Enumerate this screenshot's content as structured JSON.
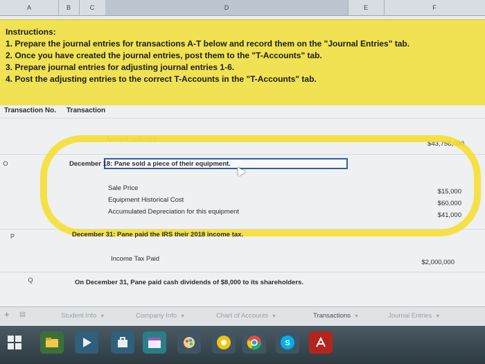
{
  "columns": [
    "A",
    "B",
    "C",
    "D",
    "E",
    "F"
  ],
  "instructions": {
    "heading": "Instructions:",
    "items": [
      "1. Prepare the journal entries for transactions A-T below and record them on the \"Journal Entries\" tab.",
      "2. Once you have created the journal entries, post them to the \"T-Accounts\" tab.",
      "3. Prepare journal entries for adjusting journal entries 1-6.",
      "4. Post the adjusting entries to the correct T-Accounts in the \"T-Accounts\" tab."
    ]
  },
  "table_header": {
    "transaction_no": "Transaction No.",
    "transaction": "Transaction"
  },
  "rows": {
    "amount_collected": {
      "label": "Amount collected",
      "value": "$43,758,000"
    },
    "O": {
      "id": "O",
      "description": "December 18: Pane sold a piece of their equipment.",
      "details": [
        {
          "label": "Sale Price",
          "value": "$15,000"
        },
        {
          "label": "Equipment Historical Cost",
          "value": "$60,000"
        },
        {
          "label": "Accumulated Depreciation for this equipment",
          "value": "$41,000"
        }
      ]
    },
    "P": {
      "id": "P",
      "description": "December 31: Pane paid the IRS their 2018 income tax.",
      "detail_label": "Income Tax Paid",
      "detail_value": "$2,000,000"
    },
    "Q": {
      "id": "Q",
      "description": "On December 31, Pane paid cash dividends of $8,000 to its shareholders."
    }
  },
  "sheet_tabs": [
    "Student Info",
    "Company Info",
    "Chart of Accounts",
    "Transactions",
    "Journal Entries"
  ],
  "active_tab": "Transactions",
  "highlight_color": "#f6de28",
  "taskbar_icons": [
    "windows-start-icon",
    "file-explorer-icon",
    "media-player-icon",
    "store-icon",
    "calendar-icon",
    "paint-icon",
    "chrome-icon",
    "google-chrome-icon",
    "skype-icon",
    "acrobat-icon"
  ]
}
